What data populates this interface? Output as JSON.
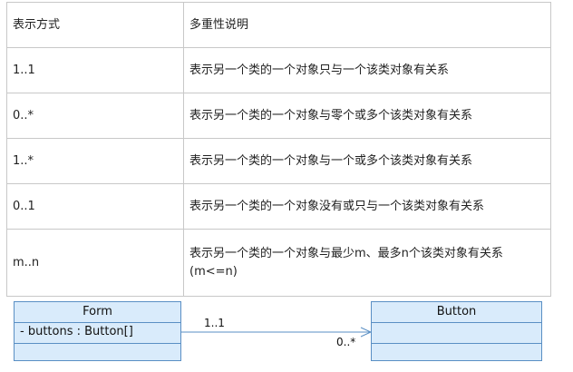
{
  "table": {
    "headers": [
      "表示方式",
      "多重性说明"
    ],
    "rows": [
      {
        "notation": "1..1",
        "description": "表示另一个类的一个对象只与一个该类对象有关系"
      },
      {
        "notation": "0..*",
        "description": "表示另一个类的一个对象与零个或多个该类对象有关系"
      },
      {
        "notation": "1..*",
        "description": "表示另一个类的一个对象与一个或多个该类对象有关系"
      },
      {
        "notation": "0..1",
        "description": "表示另一个类的一个对象没有或只与一个该类对象有关系"
      },
      {
        "notation": "m..n",
        "description": "表示另一个类的一个对象与最少m、最多n个该类对象有关系",
        "description_line2": "(m<=n)"
      }
    ]
  },
  "diagram": {
    "form_class": {
      "name": "Form",
      "attribute": "- buttons : Button[]"
    },
    "button_class": {
      "name": "Button"
    },
    "association": {
      "source_multiplicity": "1..1",
      "target_multiplicity": "0..*"
    },
    "colors": {
      "class_fill": "#d9ebfb",
      "class_border": "#5a8fc4",
      "line": "#5a8fc4"
    }
  }
}
